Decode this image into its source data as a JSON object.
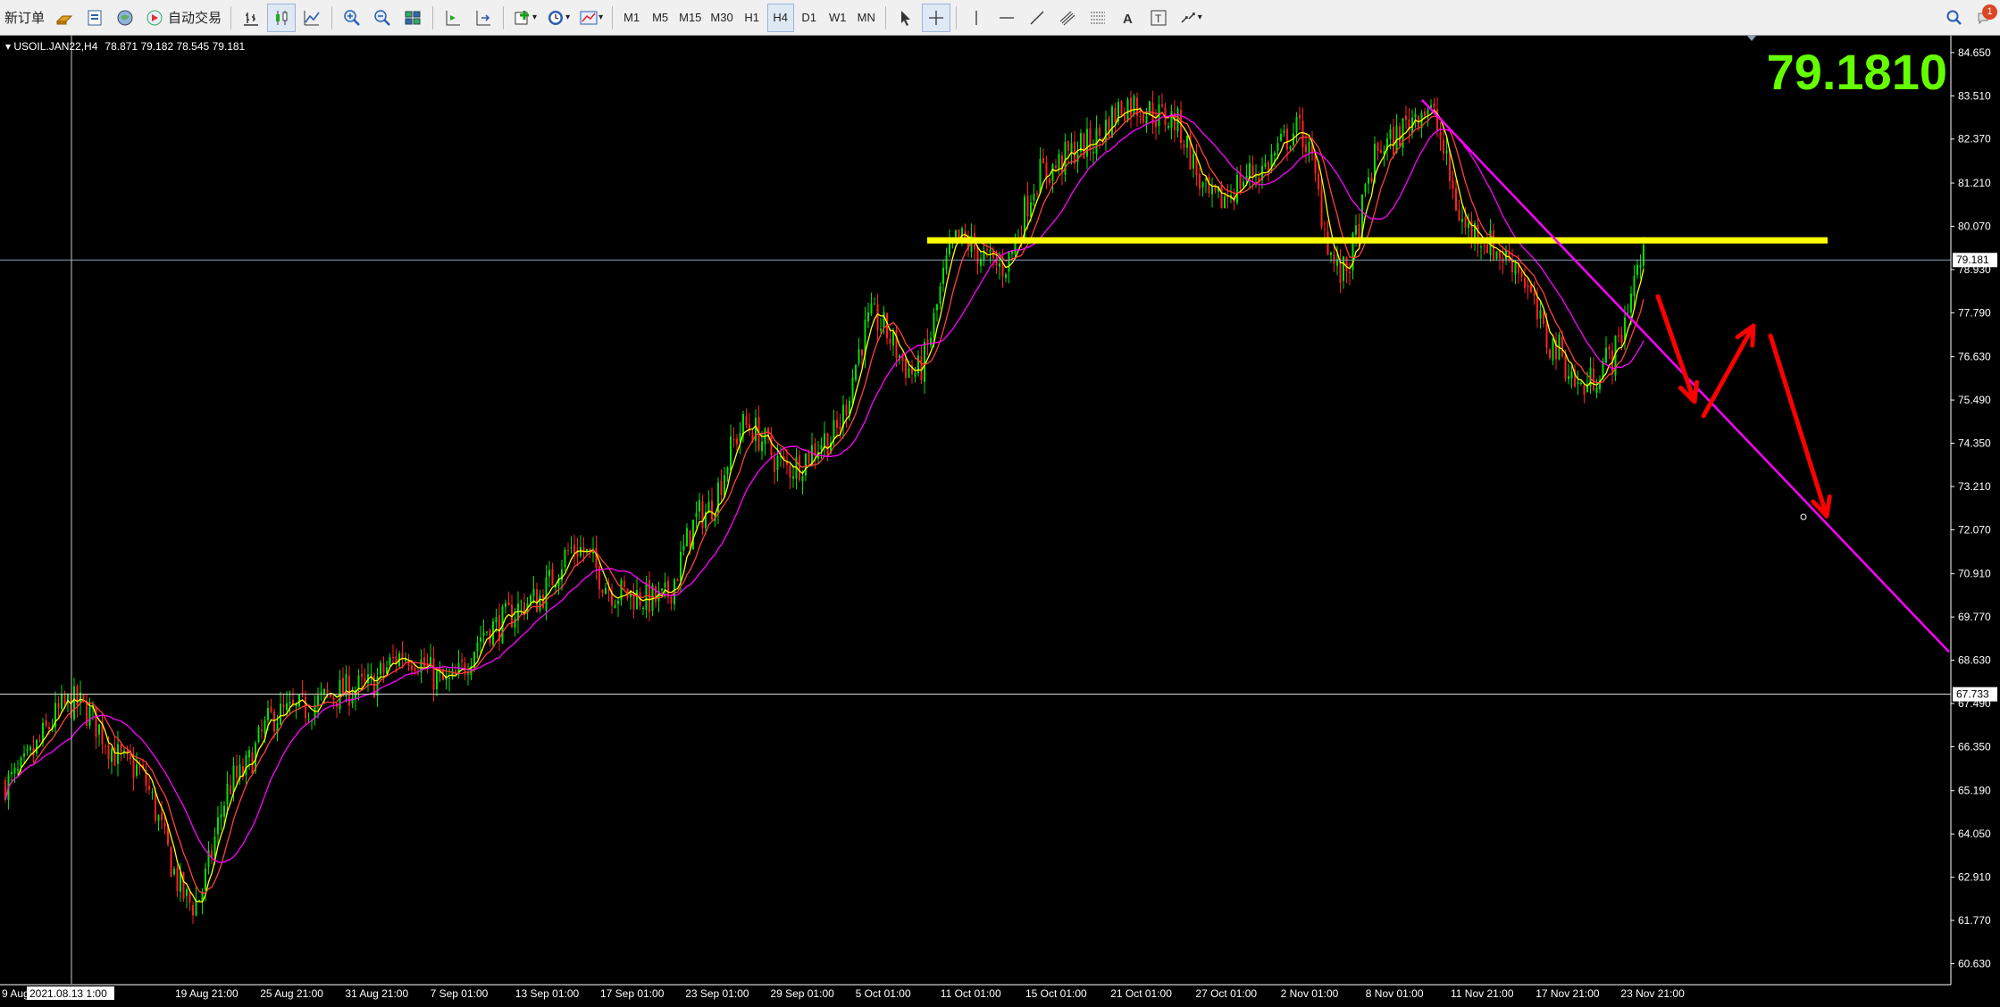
{
  "toolbar": {
    "new_order": "新订单",
    "auto_trade": "自动交易",
    "timeframes": [
      "M1",
      "M5",
      "M15",
      "M30",
      "H1",
      "H4",
      "D1",
      "W1",
      "MN"
    ],
    "active_timeframe": "H4",
    "notification_count": "1"
  },
  "chart_header": {
    "symbol": "USOIL.JAN22,H4",
    "ohlc": "78.871 79.182 78.545 79.181"
  },
  "big_price": "79.1810",
  "current_price_label": "79.181",
  "crosshair_price_label": "67.733",
  "crosshair_time_label": "2021.08.13 1:00",
  "colors": {
    "background": "#000000",
    "bull_candle": "#00e000",
    "bear_candle": "#ff2020",
    "ma_fast": "#ffff00",
    "ma_mid": "#ff4040",
    "ma_slow": "#ff00ff",
    "support_line": "#ffff00",
    "trend_line": "#ff00ff",
    "arrows": "#ff0000",
    "big_price": "#66ff00"
  },
  "chart_data": {
    "type": "candlestick",
    "symbol": "USOIL.JAN22",
    "timeframe": "H4",
    "y_ticks": [
      "84.650",
      "83.510",
      "82.370",
      "81.210",
      "80.070",
      "78.930",
      "77.790",
      "76.630",
      "75.490",
      "74.350",
      "73.210",
      "72.070",
      "70.910",
      "69.770",
      "68.630",
      "67.490",
      "66.350",
      "65.190",
      "64.050",
      "62.910",
      "61.770",
      "60.630"
    ],
    "ylim": [
      60.1,
      85.0
    ],
    "x_labels": [
      "9 Aug",
      "2021.08.13 1:00",
      "19 Aug 21:00",
      "25 Aug 21:00",
      "31 Aug 21:00",
      "7 Sep 01:00",
      "13 Sep 01:00",
      "17 Sep 01:00",
      "23 Sep 01:00",
      "29 Sep 01:00",
      "5 Oct 01:00",
      "11 Oct 01:00",
      "15 Oct 01:00",
      "21 Oct 01:00",
      "27 Oct 01:00",
      "2 Nov 01:00",
      "8 Nov 01:00",
      "11 Nov 21:00",
      "17 Nov 21:00",
      "23 Nov 21:00"
    ],
    "close_path": [
      {
        "x": "9 Aug",
        "y": 65.4
      },
      {
        "x": "2021.08.13 1:00",
        "y": 67.5
      },
      {
        "x": "15 Aug",
        "y": 65.8
      },
      {
        "x": "19 Aug 21:00",
        "y": 62.2
      },
      {
        "x": "23 Aug",
        "y": 65.5
      },
      {
        "x": "25 Aug 21:00",
        "y": 67.2
      },
      {
        "x": "31 Aug 21:00",
        "y": 67.9
      },
      {
        "x": "3 Sep",
        "y": 68.8
      },
      {
        "x": "7 Sep 01:00",
        "y": 68.0
      },
      {
        "x": "10 Sep",
        "y": 69.5
      },
      {
        "x": "13 Sep 01:00",
        "y": 70.2
      },
      {
        "x": "15 Sep",
        "y": 71.6
      },
      {
        "x": "17 Sep 01:00",
        "y": 70.4
      },
      {
        "x": "21 Sep",
        "y": 70.2
      },
      {
        "x": "23 Sep 01:00",
        "y": 72.5
      },
      {
        "x": "27 Sep",
        "y": 74.8
      },
      {
        "x": "29 Sep 01:00",
        "y": 73.7
      },
      {
        "x": "1 Oct",
        "y": 74.5
      },
      {
        "x": "5 Oct 01:00",
        "y": 77.6
      },
      {
        "x": "7 Oct",
        "y": 76.2
      },
      {
        "x": "11 Oct 01:00",
        "y": 79.7
      },
      {
        "x": "13 Oct",
        "y": 79.0
      },
      {
        "x": "15 Oct 01:00",
        "y": 81.5
      },
      {
        "x": "19 Oct",
        "y": 82.2
      },
      {
        "x": "21 Oct 01:00",
        "y": 83.3
      },
      {
        "x": "25 Oct",
        "y": 82.9
      },
      {
        "x": "27 Oct 01:00",
        "y": 80.7
      },
      {
        "x": "29 Oct",
        "y": 81.5
      },
      {
        "x": "2 Nov 01:00",
        "y": 82.6
      },
      {
        "x": "4 Nov",
        "y": 78.8
      },
      {
        "x": "8 Nov 01:00",
        "y": 82.2
      },
      {
        "x": "9 Nov",
        "y": 83.2
      },
      {
        "x": "11 Nov 21:00",
        "y": 80.0
      },
      {
        "x": "15 Nov",
        "y": 79.2
      },
      {
        "x": "17 Nov 21:00",
        "y": 76.9
      },
      {
        "x": "19 Nov",
        "y": 75.8
      },
      {
        "x": "22 Nov",
        "y": 76.6
      },
      {
        "x": "23 Nov 21:00",
        "y": 79.18
      }
    ],
    "horizontal_levels": [
      79.181,
      67.733
    ],
    "support_line_level": 79.7,
    "grid": false
  }
}
